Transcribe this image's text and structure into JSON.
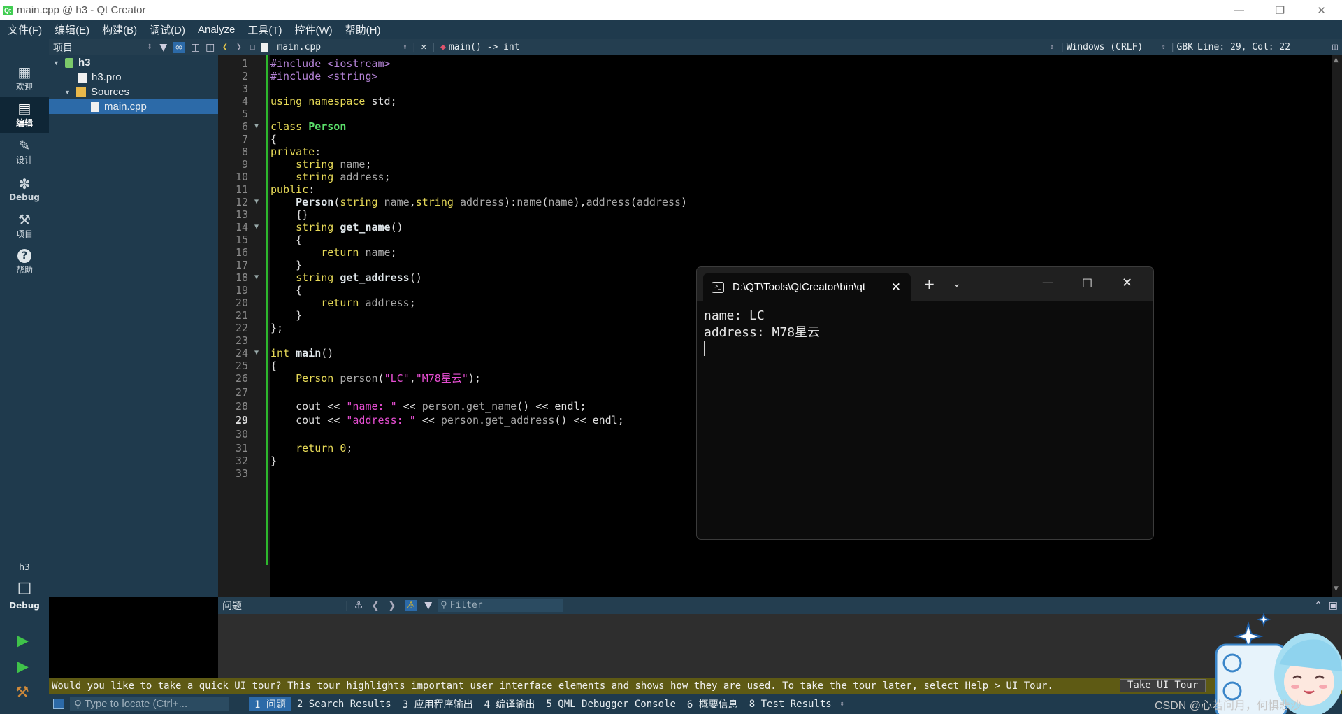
{
  "window": {
    "title": "main.cpp @ h3 - Qt Creator",
    "app_icon": "qt-logo-icon"
  },
  "menus": [
    "文件(F)",
    "编辑(E)",
    "构建(B)",
    "调试(D)",
    "Analyze",
    "工具(T)",
    "控件(W)",
    "帮助(H)"
  ],
  "modes": [
    {
      "label": "欢迎",
      "icon": "grid-icon"
    },
    {
      "label": "编辑",
      "icon": "edit-icon",
      "active": true
    },
    {
      "label": "设计",
      "icon": "pencil-icon"
    },
    {
      "label": "Debug",
      "icon": "bug-icon"
    },
    {
      "label": "项目",
      "icon": "wrench-icon"
    },
    {
      "label": "帮助",
      "icon": "help-icon"
    }
  ],
  "kit": {
    "project": "h3",
    "mode": "Debug"
  },
  "project_pane": {
    "title": "项目",
    "tree": {
      "project": "h3",
      "pro_file": "h3.pro",
      "folder": "Sources",
      "file": "main.cpp"
    }
  },
  "editor": {
    "file": "main.cpp",
    "symbol": "main() -> int",
    "line_ending": "Windows (CRLF)",
    "encoding": "GBK",
    "position": "Line: 29, Col: 22",
    "current_line": 29
  },
  "code_lines": [
    "#include <iostream>",
    "#include <string>",
    "",
    "using namespace std;",
    "",
    "class Person",
    "{",
    "private:",
    "    string name;",
    "    string address;",
    "public:",
    "    Person(string name,string address):name(name),address(address)",
    "    {}",
    "    string get_name()",
    "    {",
    "        return name;",
    "    }",
    "    string get_address()",
    "    {",
    "        return address;",
    "    }",
    "};",
    "",
    "int main()",
    "{",
    "    Person person(\"LC\",\"M78星云\");",
    "",
    "    cout << \"name: \" << person.get_name() << endl;",
    "    cout << \"address: \" << person.get_address() << endl;",
    "",
    "    return 0;",
    "}",
    ""
  ],
  "terminal": {
    "tab_title": "D:\\QT\\Tools\\QtCreator\\bin\\qt",
    "lines": [
      "name: LC",
      "address: M78星云"
    ]
  },
  "issues": {
    "title": "问题",
    "filter_placeholder": "Filter"
  },
  "tour": {
    "message": "Would you like to take a quick UI tour? This tour highlights important user interface elements and shows how they are used. To take the tour later, select Help > UI Tour.",
    "button": "Take UI Tour"
  },
  "statusbar": {
    "locator_placeholder": "Type to locate (Ctrl+...",
    "tabs": [
      "1 问题",
      "2 Search Results",
      "3 应用程序输出",
      "4 编译输出",
      "5 QML Debugger Console",
      "6 概要信息",
      "8 Test Results"
    ],
    "watermark": "CSDN @心若问月，何惧悲沙"
  }
}
